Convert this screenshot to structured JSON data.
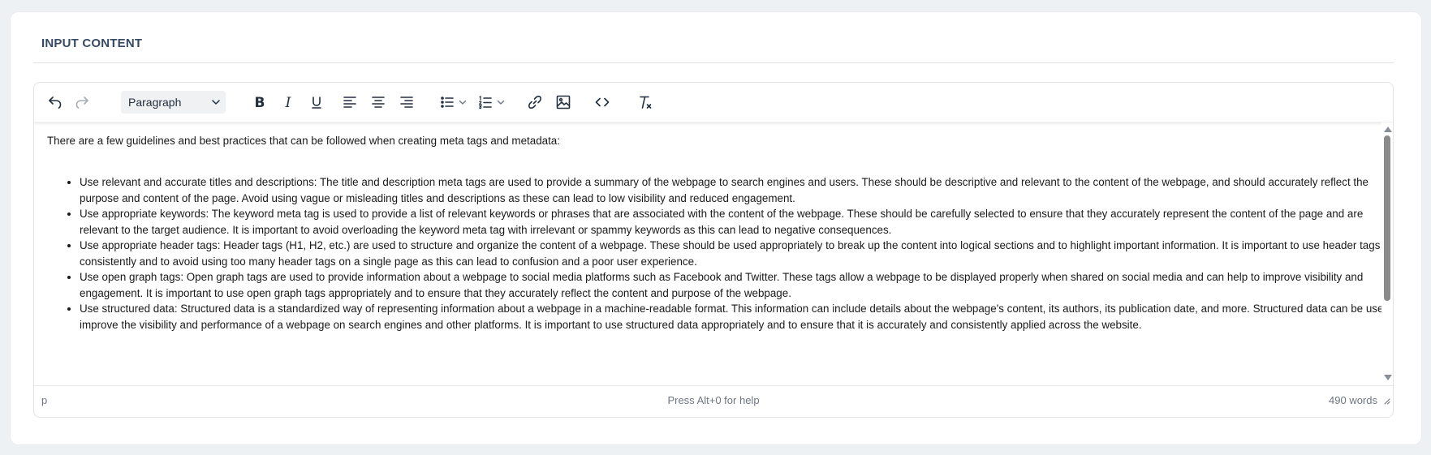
{
  "panel": {
    "title": "INPUT CONTENT"
  },
  "toolbar": {
    "undo_icon": "undo-icon",
    "redo_icon": "redo-icon",
    "block_format": "Paragraph",
    "bold_icon": "bold-icon",
    "italic_icon": "italic-icon",
    "underline_icon": "underline-icon",
    "align_left_icon": "align-left-icon",
    "align_center_icon": "align-center-icon",
    "align_right_icon": "align-right-icon",
    "bullet_list_icon": "bullet-list-icon",
    "numbered_list_icon": "numbered-list-icon",
    "link_icon": "link-icon",
    "image_icon": "image-icon",
    "code_icon": "code-icon",
    "clear_format_icon": "clear-format-icon"
  },
  "content": {
    "intro": "There are a few guidelines and best practices that can be followed when creating meta tags and metadata:",
    "items": [
      "Use relevant and accurate titles and descriptions: The title and description meta tags are used to provide a summary of the webpage to search engines and users. These should be descriptive and relevant to the content of the webpage, and should accurately reflect the purpose and content of the page. Avoid using vague or misleading titles and descriptions as these can lead to low visibility and reduced engagement.",
      "Use appropriate keywords: The keyword meta tag is used to provide a list of relevant keywords or phrases that are associated with the content of the webpage. These should be carefully selected to ensure that they accurately represent the content of the page and are relevant to the target audience. It is important to avoid overloading the keyword meta tag with irrelevant or spammy keywords as this can lead to negative consequences.",
      "Use appropriate header tags: Header tags (H1, H2, etc.) are used to structure and organize the content of a webpage. These should be used appropriately to break up the content into logical sections and to highlight important information. It is important to use header tags consistently and to avoid using too many header tags on a single page as this can lead to confusion and a poor user experience.",
      "Use open graph tags: Open graph tags are used to provide information about a webpage to social media platforms such as Facebook and Twitter. These tags allow a webpage to be displayed properly when shared on social media and can help to improve visibility and engagement. It is important to use open graph tags appropriately and to ensure that they accurately reflect the content and purpose of the webpage.",
      "Use structured data: Structured data is a standardized way of representing information about a webpage in a machine-readable format. This information can include details about the webpage's content, its authors, its publication date, and more. Structured data can be used to improve the visibility and performance of a webpage on search engines and other platforms. It is important to use structured data appropriately and to ensure that it is accurately and consistently applied across the website."
    ]
  },
  "statusbar": {
    "element_path": "p",
    "help_text": "Press Alt+0 for help",
    "word_count": "490 words"
  },
  "colors": {
    "title": "#364a63",
    "icon": "#222f3e",
    "icon_disabled": "#a7adb5",
    "scroll_thumb": "#8b8b8b"
  }
}
